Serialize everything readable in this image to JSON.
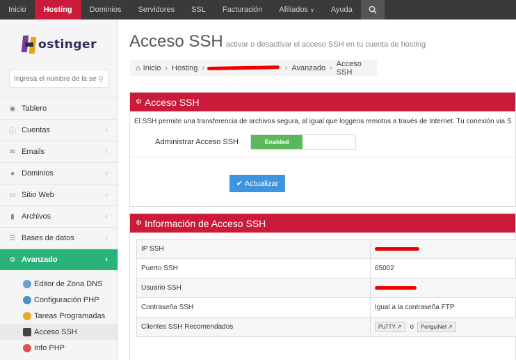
{
  "nav": {
    "items": [
      "Inicio",
      "Hosting",
      "Dominios",
      "Servidores",
      "SSL",
      "Facturación",
      "Afiliados",
      "Ayuda"
    ],
    "active": "Hosting",
    "search_icon": "search-icon"
  },
  "sidebar": {
    "logo_text": "ostinger",
    "search_placeholder": "Ingresa el nombre de la se",
    "menu": [
      {
        "label": "Tablero",
        "icon": "dashboard-icon"
      },
      {
        "label": "Cuentas",
        "icon": "info-icon"
      },
      {
        "label": "Emails",
        "icon": "envelope-icon"
      },
      {
        "label": "Dominios",
        "icon": "globe-icon"
      },
      {
        "label": "Sitio Web",
        "icon": "monitor-icon"
      },
      {
        "label": "Archivos",
        "icon": "folder-icon"
      },
      {
        "label": "Bases de datos",
        "icon": "database-icon"
      },
      {
        "label": "Avanzado",
        "icon": "gears-icon"
      }
    ],
    "submenu": [
      {
        "label": "Editor de Zona DNS",
        "icon": "dns-icon"
      },
      {
        "label": "Configuración PHP",
        "icon": "php-config-icon"
      },
      {
        "label": "Tareas Programadas",
        "icon": "cron-icon"
      },
      {
        "label": "Acceso SSH",
        "icon": "ssh-icon"
      },
      {
        "label": "Info PHP",
        "icon": "php-info-icon"
      }
    ]
  },
  "page": {
    "title": "Acceso SSH",
    "subtitle": "activar o desactivar el acceso SSH en tu cuenta de hosting",
    "breadcrumb": [
      "Inicio",
      "Hosting",
      "Avanzado",
      "Acceso SSH"
    ]
  },
  "ssh_panel": {
    "heading": "Acceso SSH",
    "description": "El SSH permite una transferencia de archivos segura, al igual que loggeos remotos a través de Internet. Tu conexión via S",
    "toggle_label": "Administrar Acceso SSH",
    "toggle_state": "Enabled",
    "update_button": "Actualizar"
  },
  "info_panel": {
    "heading": "Información de Acceso SSH",
    "rows": [
      {
        "key": "IP SSH",
        "value": ""
      },
      {
        "key": "Puerto SSH",
        "value": "65002"
      },
      {
        "key": "Usuario SSH",
        "value": ""
      },
      {
        "key": "Contraseña SSH",
        "value": "Igual a la contraseña FTP"
      },
      {
        "key": "Clientes SSH Recomendados",
        "value": ""
      }
    ],
    "clients": [
      "PuTTY",
      "PenguiNet"
    ],
    "clients_separator": "o"
  },
  "colors": {
    "brand_red": "#cc1a3b",
    "active_green": "#2ab27b",
    "button_blue": "#3e95df",
    "toggle_green": "#5cb85c"
  }
}
